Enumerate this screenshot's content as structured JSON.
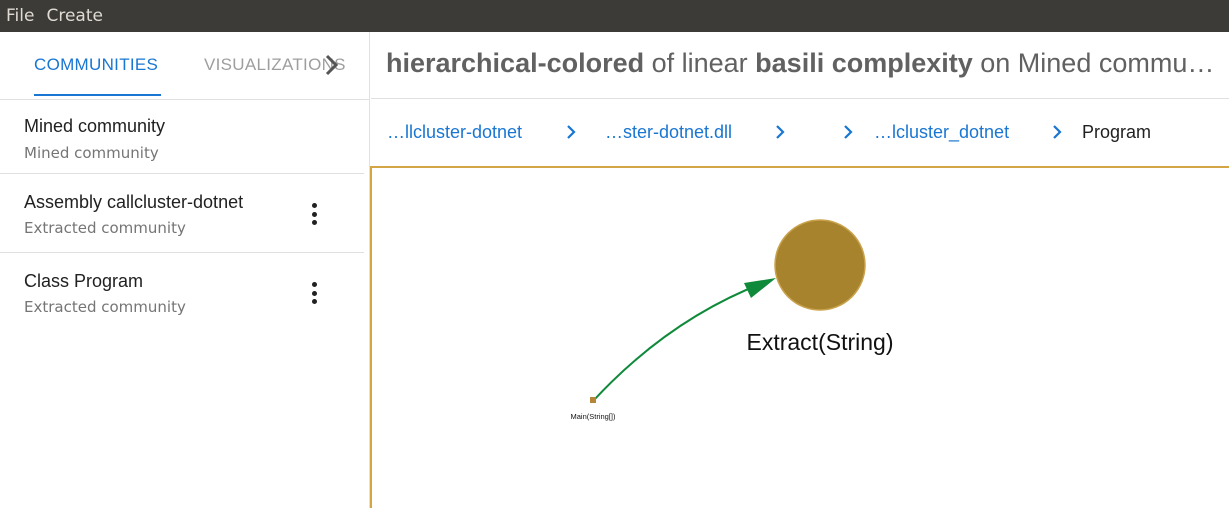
{
  "menubar": {
    "items": [
      "File",
      "Create"
    ]
  },
  "sidebar": {
    "tabs": [
      {
        "label": "COMMUNITIES",
        "active": true
      },
      {
        "label": "VISUALIZATIONS",
        "active": false
      }
    ],
    "items": [
      {
        "title": "Mined community",
        "subtitle": "Mined community",
        "has_menu": false
      },
      {
        "title": "Assembly callcluster-dotnet",
        "subtitle": "Extracted community",
        "has_menu": true
      },
      {
        "title": "Class Program",
        "subtitle": "Extracted community",
        "has_menu": true
      }
    ]
  },
  "header": {
    "title_parts": [
      {
        "text": "hierarchical-colored",
        "bold": true
      },
      {
        "text": " of linear ",
        "bold": false
      },
      {
        "text": "basili complexity",
        "bold": true
      },
      {
        "text": " on Mined community",
        "bold": false
      }
    ]
  },
  "breadcrumbs": [
    {
      "label": "…llcluster-dotnet",
      "current": false
    },
    {
      "label": "…ster-dotnet.dll",
      "current": false
    },
    {
      "label": "",
      "current": false
    },
    {
      "label": "…lcluster_dotnet",
      "current": false
    },
    {
      "label": "Program",
      "current": true
    }
  ],
  "graph": {
    "nodes": [
      {
        "label": "Extract(String)",
        "color": "#a8832e",
        "shape": "circle"
      },
      {
        "label": "Main(String[])",
        "color": "#b5863a",
        "shape": "square"
      }
    ],
    "edges": [
      {
        "from": "Main(String[])",
        "to": "Extract(String)",
        "color": "#0f8a3a"
      }
    ]
  },
  "colors": {
    "accent": "#1976d2",
    "menubar_bg": "#3c3b37",
    "canvas_border": "#d3a545"
  }
}
